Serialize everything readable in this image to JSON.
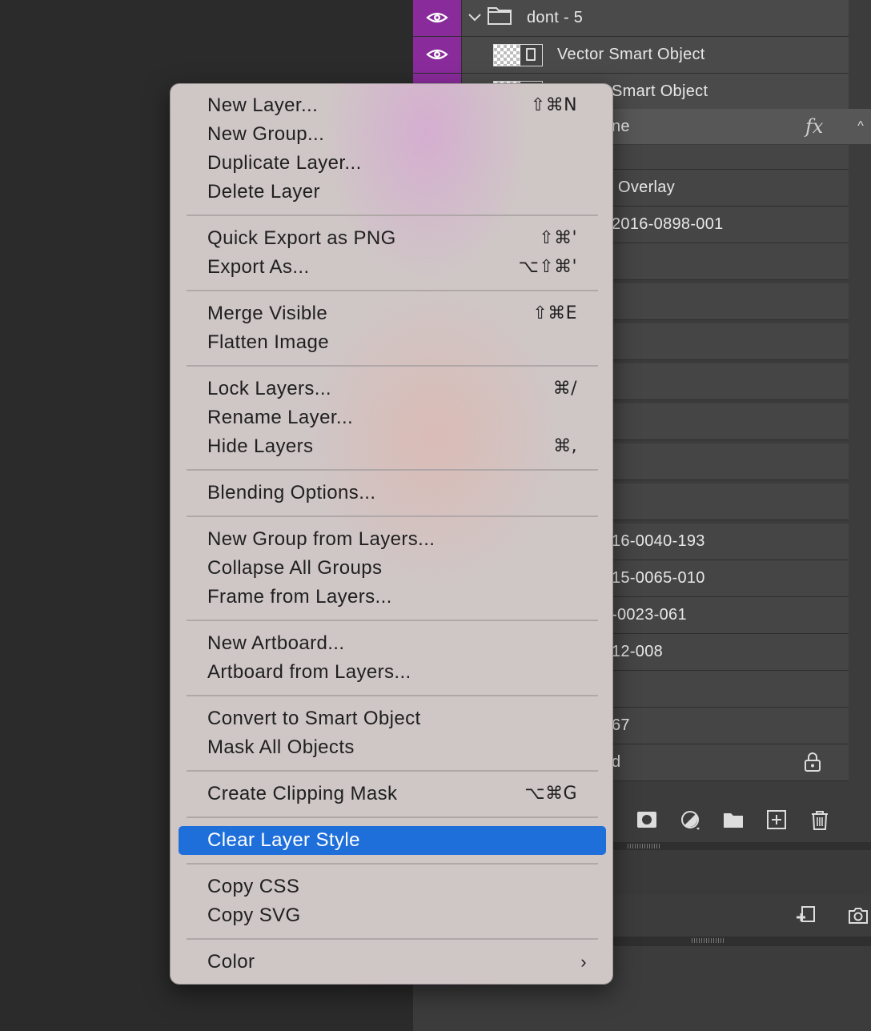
{
  "layers": [
    {
      "label": "dont - 5",
      "kind": "group",
      "visible": true
    },
    {
      "label": "Vector Smart Object",
      "kind": "smart-object",
      "visible": true
    },
    {
      "label": "Smart Object",
      "kind": "smart-object",
      "visible": true
    },
    {
      "label": "ne",
      "kind": "effects",
      "fx": "fx"
    },
    {
      "label": "Overlay",
      "kind": "text"
    },
    {
      "label": "2016-0898-001",
      "kind": "text"
    },
    {
      "label": "16-0040-193",
      "kind": "text"
    },
    {
      "label": "15-0065-010",
      "kind": "text"
    },
    {
      "label": "-0023-061",
      "kind": "text"
    },
    {
      "label": "12-008",
      "kind": "text"
    },
    {
      "label": "67",
      "kind": "text"
    },
    {
      "label": "d",
      "kind": "text"
    }
  ],
  "panel_collapse_glyph": "^",
  "menu": {
    "groups": [
      [
        {
          "label": "New Layer...",
          "shortcut": "⇧⌘N"
        },
        {
          "label": "New Group...",
          "shortcut": ""
        },
        {
          "label": "Duplicate Layer...",
          "shortcut": ""
        },
        {
          "label": "Delete Layer",
          "shortcut": ""
        }
      ],
      [
        {
          "label": "Quick Export as PNG",
          "shortcut": "⇧⌘'"
        },
        {
          "label": "Export As...",
          "shortcut": "⌥⇧⌘'"
        }
      ],
      [
        {
          "label": "Merge Visible",
          "shortcut": "⇧⌘E"
        },
        {
          "label": "Flatten Image",
          "shortcut": ""
        }
      ],
      [
        {
          "label": "Lock Layers...",
          "shortcut": "⌘/"
        },
        {
          "label": "Rename Layer...",
          "shortcut": ""
        },
        {
          "label": "Hide Layers",
          "shortcut": "⌘,"
        }
      ],
      [
        {
          "label": "Blending Options...",
          "shortcut": ""
        }
      ],
      [
        {
          "label": "New Group from Layers...",
          "shortcut": ""
        },
        {
          "label": "Collapse All Groups",
          "shortcut": ""
        },
        {
          "label": "Frame from Layers...",
          "shortcut": ""
        }
      ],
      [
        {
          "label": "New Artboard...",
          "shortcut": ""
        },
        {
          "label": "Artboard from Layers...",
          "shortcut": ""
        }
      ],
      [
        {
          "label": "Convert to Smart Object",
          "shortcut": ""
        },
        {
          "label": "Mask All Objects",
          "shortcut": ""
        }
      ],
      [
        {
          "label": "Create Clipping Mask",
          "shortcut": "⌥⌘G"
        }
      ],
      [
        {
          "label": "Clear Layer Style",
          "shortcut": "",
          "highlighted": true
        }
      ],
      [
        {
          "label": "Copy CSS",
          "shortcut": ""
        },
        {
          "label": "Copy SVG",
          "shortcut": ""
        }
      ],
      [
        {
          "label": "Color",
          "shortcut": "",
          "submenu": true
        }
      ]
    ],
    "submenu_glyph": "›"
  },
  "colors": {
    "visibility_column": "#8a2b9c",
    "highlight": "#1f6fdb",
    "menu_background": "#cfc6c6"
  },
  "icons": [
    "eye-icon",
    "chevron-down-icon",
    "folder-icon",
    "smart-object-thumbnail",
    "fx-icon",
    "lock-icon",
    "mask-icon",
    "adjustment-icon",
    "new-group-icon",
    "new-layer-icon",
    "trash-icon",
    "import-icon",
    "camera-icon"
  ]
}
